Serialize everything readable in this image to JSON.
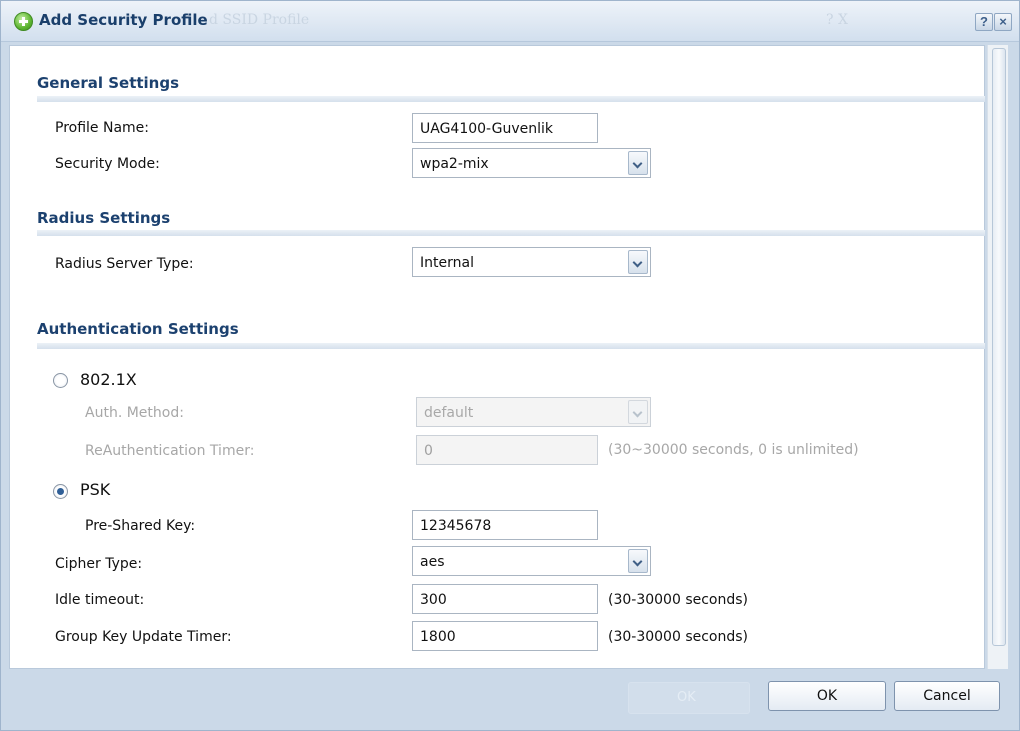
{
  "dialog": {
    "title": "Add Security Profile",
    "ghost_title": "d SSID Profile",
    "ghost_right": "? X",
    "help_label": "?",
    "close_label": "×"
  },
  "general": {
    "title": "General Settings",
    "profile_name_label": "Profile Name:",
    "profile_name_value": "UAG4100-Guvenlik",
    "security_mode_label": "Security Mode:",
    "security_mode_value": "wpa2-mix"
  },
  "radius": {
    "title": "Radius Settings",
    "server_type_label": "Radius Server Type:",
    "server_type_value": "Internal"
  },
  "auth": {
    "title": "Authentication Settings",
    "option_8021x": "802.1X",
    "auth_method_label": "Auth. Method:",
    "auth_method_value": "default",
    "reauth_label": "ReAuthentication Timer:",
    "reauth_value": "0",
    "reauth_hint": "(30~30000 seconds, 0 is unlimited)",
    "option_psk": "PSK",
    "psk_label": "Pre-Shared Key:",
    "psk_value": "12345678",
    "cipher_label": "Cipher Type:",
    "cipher_value": "aes",
    "idle_label": "Idle timeout:",
    "idle_value": "300",
    "idle_hint": "(30-30000 seconds)",
    "group_label": "Group Key Update Timer:",
    "group_value": "1800",
    "group_hint": "(30-30000 seconds)"
  },
  "footer": {
    "ghost_ok": "OK",
    "ok_label": "OK",
    "cancel_label": "Cancel"
  },
  "colors": {
    "section_title": "#1c416f",
    "dialog_bg": "#cbd9e8",
    "disabled_text": "#a7a7a7"
  }
}
